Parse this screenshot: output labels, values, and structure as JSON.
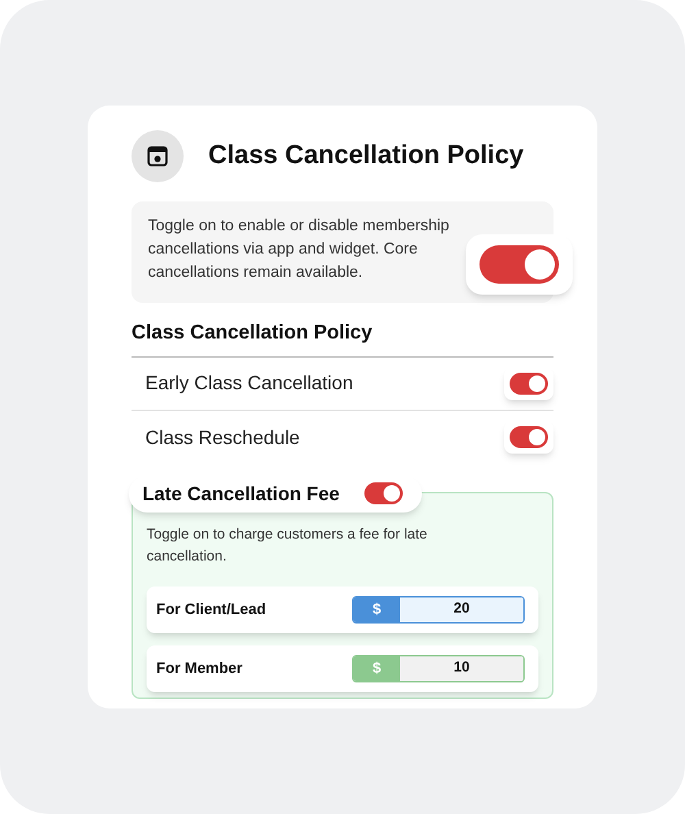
{
  "title": "Class Cancellation Policy",
  "intro": {
    "text": "Toggle on to enable or disable membership cancellations via app and widget. Core cancellations remain available.",
    "on": true
  },
  "section_title": "Class Cancellation Policy",
  "options": [
    {
      "label": "Early Class Cancellation",
      "on": true
    },
    {
      "label": "Class Reschedule",
      "on": true
    }
  ],
  "late_fee": {
    "label": "Late Cancellation Fee",
    "on": true,
    "description": "Toggle on to charge customers a fee for late cancellation.",
    "fees": [
      {
        "label": "For Client/Lead",
        "currency": "$",
        "value": "20",
        "color": "#4a90d9"
      },
      {
        "label": "For Member",
        "currency": "$",
        "value": "10",
        "color": "#8cc98f"
      }
    ]
  }
}
